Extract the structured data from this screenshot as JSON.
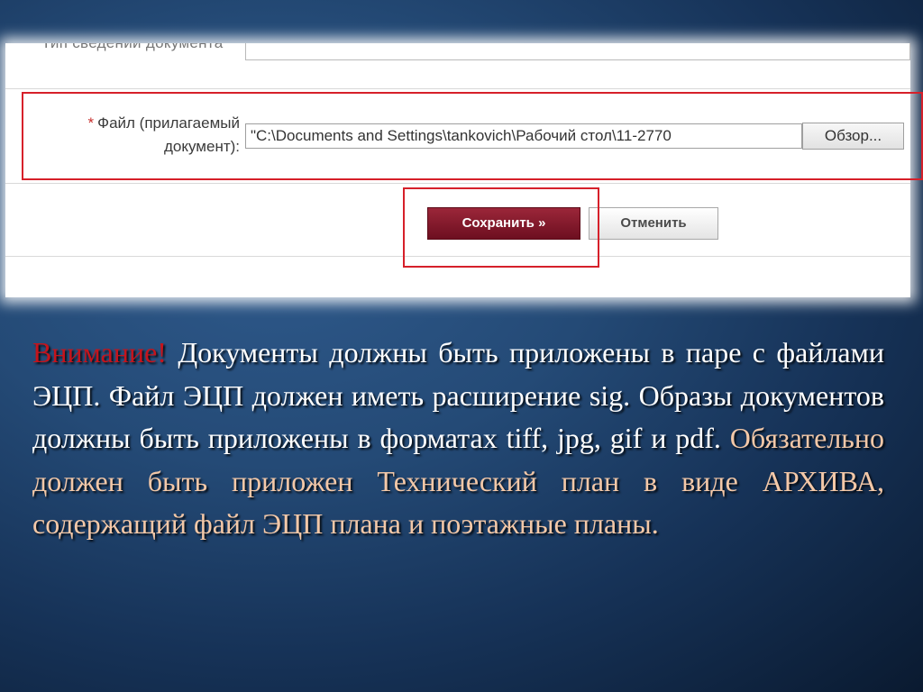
{
  "form": {
    "prev_label": "Тип сведений документа",
    "file_label_line1": "Файл (прилагаемый",
    "file_label_line2": "документ):",
    "required_mark": "*",
    "file_value": "\"C:\\Documents and Settings\\tankovich\\Рабочий стол\\11-2770",
    "browse_label": "Обзор...",
    "save_label": "Сохранить »",
    "cancel_label": "Отменить"
  },
  "note": {
    "warning": "Внимание!",
    "part1": " Документы должны быть приложены в паре с файлами ЭЦП. Файл ЭЦП должен иметь расширение sig. Образы документов должны быть приложены в форматах tiff, jpg, gif и pdf. ",
    "part2": "Обязательно должен быть приложен Технический план в виде АРХИВА, содержащий файл ЭЦП плана и поэтажные планы."
  },
  "colors": {
    "highlight": "#d6202a",
    "save_button": "#7d1528",
    "warning_text": "#c4141c",
    "accent_text": "#f3c8a8"
  }
}
